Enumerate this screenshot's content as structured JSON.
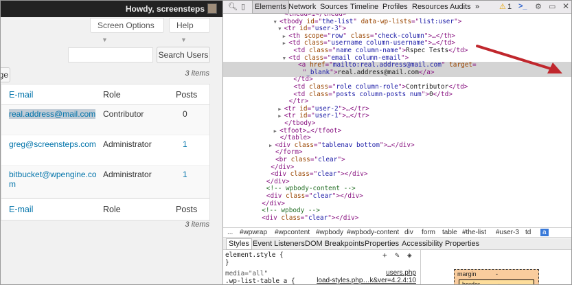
{
  "wp": {
    "adminbar": {
      "greeting": "Howdy, screensteps"
    },
    "screen_options": "Screen Options",
    "help": "Help",
    "search_button": "Search Users",
    "page_button": "ge",
    "items_top": "3 items",
    "items_bottom": "3 items",
    "table": {
      "columns": {
        "email": "E-mail",
        "role": "Role",
        "posts": "Posts"
      },
      "rows": [
        {
          "email": "real.address@mail.com",
          "role": "Contributor",
          "posts": "0"
        },
        {
          "email": "greg@screensteps.com",
          "role": "Administrator",
          "posts": "1"
        },
        {
          "email_line1": "bitbucket@wpengine.co",
          "email_line2": "m",
          "role": "Administrator",
          "posts": "1"
        }
      ]
    }
  },
  "devtools": {
    "tabs": [
      "Elements",
      "Network",
      "Sources",
      "Timeline",
      "Profiles",
      "Resources",
      "Audits",
      "»"
    ],
    "warning_count": "1",
    "code_lines": [
      {
        "indent": 12,
        "arrow": "",
        "parts": [
          [
            "tg",
            "<thead>…</thead>"
          ]
        ]
      },
      {
        "indent": 11,
        "arrow": "▼",
        "parts": [
          [
            "tg",
            "<tbody "
          ],
          [
            "an",
            "id"
          ],
          [
            "tg",
            "=\""
          ],
          [
            "av",
            "the-list"
          ],
          [
            "tg",
            "\" "
          ],
          [
            "an",
            "data-wp-lists"
          ],
          [
            "tg",
            "=\""
          ],
          [
            "av",
            "list:user"
          ],
          [
            "tg",
            "\">"
          ]
        ]
      },
      {
        "indent": 12,
        "arrow": "▼",
        "parts": [
          [
            "tg",
            "<tr "
          ],
          [
            "an",
            "id"
          ],
          [
            "tg",
            "=\""
          ],
          [
            "av",
            "user-3"
          ],
          [
            "tg",
            "\">"
          ]
        ]
      },
      {
        "indent": 13,
        "arrow": "▶",
        "parts": [
          [
            "tg",
            "<th "
          ],
          [
            "an",
            "scope"
          ],
          [
            "tg",
            "=\""
          ],
          [
            "av",
            "row"
          ],
          [
            "tg",
            "\" "
          ],
          [
            "an",
            "class"
          ],
          [
            "tg",
            "=\""
          ],
          [
            "av",
            "check-column"
          ],
          [
            "tg",
            "\">…</th>"
          ]
        ]
      },
      {
        "indent": 13,
        "arrow": "▶",
        "parts": [
          [
            "tg",
            "<td "
          ],
          [
            "an",
            "class"
          ],
          [
            "tg",
            "=\""
          ],
          [
            "av",
            "username column-username"
          ],
          [
            "tg",
            "\">…</td>"
          ]
        ]
      },
      {
        "indent": 14,
        "arrow": "",
        "parts": [
          [
            "tg",
            "<td "
          ],
          [
            "an",
            "class"
          ],
          [
            "tg",
            "=\""
          ],
          [
            "av",
            "name column-name"
          ],
          [
            "tg",
            "\">"
          ],
          [
            "tx",
            "Rspec Tests"
          ],
          [
            "tg",
            "</td>"
          ]
        ]
      },
      {
        "indent": 13,
        "arrow": "▼",
        "parts": [
          [
            "tg",
            "<td "
          ],
          [
            "an",
            "class"
          ],
          [
            "tg",
            "=\""
          ],
          [
            "av",
            "email column-email"
          ],
          [
            "tg",
            "\">"
          ]
        ]
      },
      {
        "indent": 15,
        "arrow": "",
        "sel": true,
        "parts": [
          [
            "tg",
            "<a "
          ],
          [
            "an",
            "href"
          ],
          [
            "tg",
            "=\""
          ],
          [
            "av",
            "mailto:real.address@mail.com"
          ],
          [
            "tg",
            "\" "
          ],
          [
            "an",
            "target"
          ],
          [
            "tg",
            "="
          ]
        ]
      },
      {
        "indent": 16,
        "arrow": "",
        "sel": true,
        "parts": [
          [
            "tg",
            "\""
          ],
          [
            "av",
            "_blank"
          ],
          [
            "tg",
            "\">"
          ],
          [
            "tx",
            "real.address@mail.com"
          ],
          [
            "tg",
            "</a>"
          ]
        ]
      },
      {
        "indent": 14,
        "arrow": "",
        "parts": [
          [
            "tg",
            "</td>"
          ]
        ]
      },
      {
        "indent": 14,
        "arrow": "",
        "parts": [
          [
            "tg",
            "<td "
          ],
          [
            "an",
            "class"
          ],
          [
            "tg",
            "=\""
          ],
          [
            "av",
            "role column-role"
          ],
          [
            "tg",
            "\">"
          ],
          [
            "tx",
            "Contributor"
          ],
          [
            "tg",
            "</td>"
          ]
        ]
      },
      {
        "indent": 14,
        "arrow": "",
        "parts": [
          [
            "tg",
            "<td "
          ],
          [
            "an",
            "class"
          ],
          [
            "tg",
            "=\""
          ],
          [
            "av",
            "posts column-posts num"
          ],
          [
            "tg",
            "\">"
          ],
          [
            "tx",
            "0"
          ],
          [
            "tg",
            "</td>"
          ]
        ]
      },
      {
        "indent": 13,
        "arrow": "",
        "parts": [
          [
            "tg",
            "</tr>"
          ]
        ]
      },
      {
        "indent": 12,
        "arrow": "▶",
        "parts": [
          [
            "tg",
            "<tr "
          ],
          [
            "an",
            "id"
          ],
          [
            "tg",
            "=\""
          ],
          [
            "av",
            "user-2"
          ],
          [
            "tg",
            "\">…</tr>"
          ]
        ]
      },
      {
        "indent": 12,
        "arrow": "▶",
        "parts": [
          [
            "tg",
            "<tr "
          ],
          [
            "an",
            "id"
          ],
          [
            "tg",
            "=\""
          ],
          [
            "av",
            "user-1"
          ],
          [
            "tg",
            "\">…</tr>"
          ]
        ]
      },
      {
        "indent": 12,
        "arrow": "",
        "parts": [
          [
            "tg",
            "</tbody>"
          ]
        ]
      },
      {
        "indent": 11,
        "arrow": "▶",
        "parts": [
          [
            "tg",
            "<tfoot>…</tfoot>"
          ]
        ]
      },
      {
        "indent": 11,
        "arrow": "",
        "parts": [
          [
            "tg",
            "</table>"
          ]
        ]
      },
      {
        "indent": 10,
        "arrow": "▶",
        "parts": [
          [
            "tg",
            "<div "
          ],
          [
            "an",
            "class"
          ],
          [
            "tg",
            "=\""
          ],
          [
            "av",
            "tablenav bottom"
          ],
          [
            "tg",
            "\">…</div>"
          ]
        ]
      },
      {
        "indent": 10,
        "arrow": "",
        "parts": [
          [
            "tg",
            "</form>"
          ]
        ]
      },
      {
        "indent": 10,
        "arrow": "",
        "parts": [
          [
            "tg",
            "<br "
          ],
          [
            "an",
            "class"
          ],
          [
            "tg",
            "=\""
          ],
          [
            "av",
            "clear"
          ],
          [
            "tg",
            "\">"
          ]
        ]
      },
      {
        "indent": 9,
        "arrow": "",
        "parts": [
          [
            "tg",
            "</div>"
          ]
        ]
      },
      {
        "indent": 9,
        "arrow": "",
        "parts": [
          [
            "tg",
            "<div "
          ],
          [
            "an",
            "class"
          ],
          [
            "tg",
            "=\""
          ],
          [
            "av",
            "clear"
          ],
          [
            "tg",
            "\"></div>"
          ]
        ]
      },
      {
        "indent": 8,
        "arrow": "",
        "parts": [
          [
            "tg",
            "</div>"
          ]
        ]
      },
      {
        "indent": 8,
        "arrow": "",
        "parts": [
          [
            "cm",
            "<!-- wpbody-content -->"
          ]
        ]
      },
      {
        "indent": 8,
        "arrow": "",
        "parts": [
          [
            "tg",
            "<div "
          ],
          [
            "an",
            "class"
          ],
          [
            "tg",
            "=\""
          ],
          [
            "av",
            "clear"
          ],
          [
            "tg",
            "\"></div>"
          ]
        ]
      },
      {
        "indent": 7,
        "arrow": "",
        "parts": [
          [
            "tg",
            "</div>"
          ]
        ]
      },
      {
        "indent": 7,
        "arrow": "",
        "parts": [
          [
            "cm",
            "<!-- wpbody -->"
          ]
        ]
      },
      {
        "indent": 7,
        "arrow": "",
        "parts": [
          [
            "tg",
            "<div "
          ],
          [
            "an",
            "class"
          ],
          [
            "tg",
            "=\""
          ],
          [
            "av",
            "clear"
          ],
          [
            "tg",
            "\"></div>"
          ]
        ]
      }
    ],
    "breadcrumbs": [
      "...",
      "#wpwrap",
      "#wpcontent",
      "#wpbody",
      "#wpbody-content",
      "div",
      "form",
      "table",
      "#the-list",
      "#user-3",
      "td",
      "a"
    ],
    "sub_tabs": [
      "Styles",
      "Event Listeners",
      "DOM Breakpoints",
      "Properties",
      "Accessibility Properties"
    ],
    "styles": {
      "line1": "element.style {",
      "line2": "}",
      "line3": "media=\"all\"",
      "line4": ".wp-list-table a {",
      "src1": "users.php",
      "src2": "load-styles.php…k&ver=4.2.4:10"
    },
    "box_model": {
      "margin": "margin",
      "margin_val": "-",
      "border": "border",
      "border_val": "-"
    }
  }
}
